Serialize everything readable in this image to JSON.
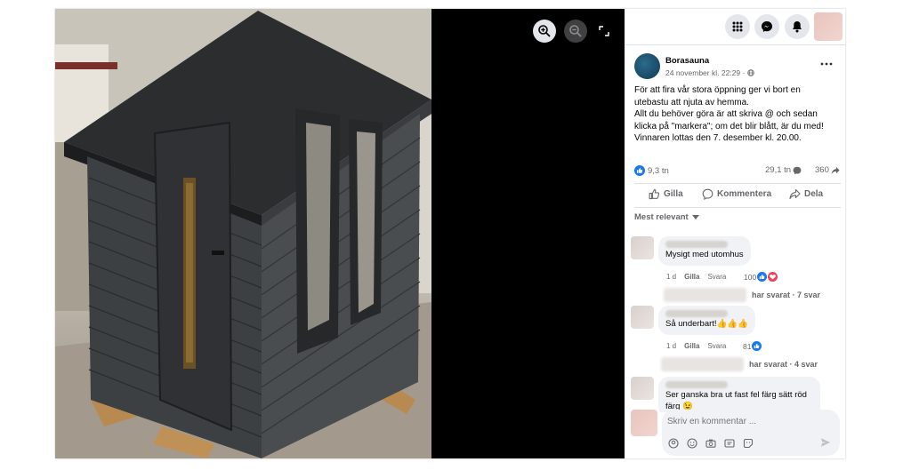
{
  "topbar": {
    "menu_icon": "grid-menu-icon",
    "messenger_icon": "messenger-icon",
    "notifications_icon": "bell-icon"
  },
  "viewer": {
    "zoom_in_icon": "zoom-in-icon",
    "zoom_out_icon": "zoom-out-icon",
    "fullscreen_icon": "fullscreen-icon"
  },
  "post": {
    "page_name": "Borasauna",
    "date": "24 november kl. 22:29 ·",
    "audience_icon": "globe-icon",
    "text_lines": [
      "För att fira vår stora öppning ger vi bort en",
      "utebastu att njuta av hemma.",
      "Allt du behöver göra är att skriva @ och sedan",
      "klicka på \"markera\"; om det blir blått, är du med!",
      "Vinnaren lottas den 7. desember kl. 20.00."
    ],
    "reactions_count": "9,3 tn",
    "comments_count": "29,1 tn",
    "shares_count": "360"
  },
  "actions": {
    "like": "Gilla",
    "comment": "Kommentera",
    "share": "Dela"
  },
  "sort": {
    "label": "Mest relevant"
  },
  "comments": [
    {
      "text": "Mysigt med utomhus",
      "time": "1 d",
      "like_label": "Gilla",
      "reply_label": "Svara",
      "reaction_count": "100",
      "replies_label": "har svarat · 7 svar"
    },
    {
      "text": "Så underbart!👍👍👍",
      "time": "1 d",
      "like_label": "Gilla",
      "reply_label": "Svara",
      "reaction_count": "81",
      "replies_label": "har svarat · 4 svar"
    },
    {
      "text": "Ser ganska bra ut fast fel färg sätt röd färg 😉"
    }
  ],
  "composer": {
    "placeholder": "Skriv en kommentar ..."
  },
  "colors": {
    "facebook_blue": "#1877f2",
    "love_red": "#f33e58",
    "secondary_text": "#65676b"
  }
}
